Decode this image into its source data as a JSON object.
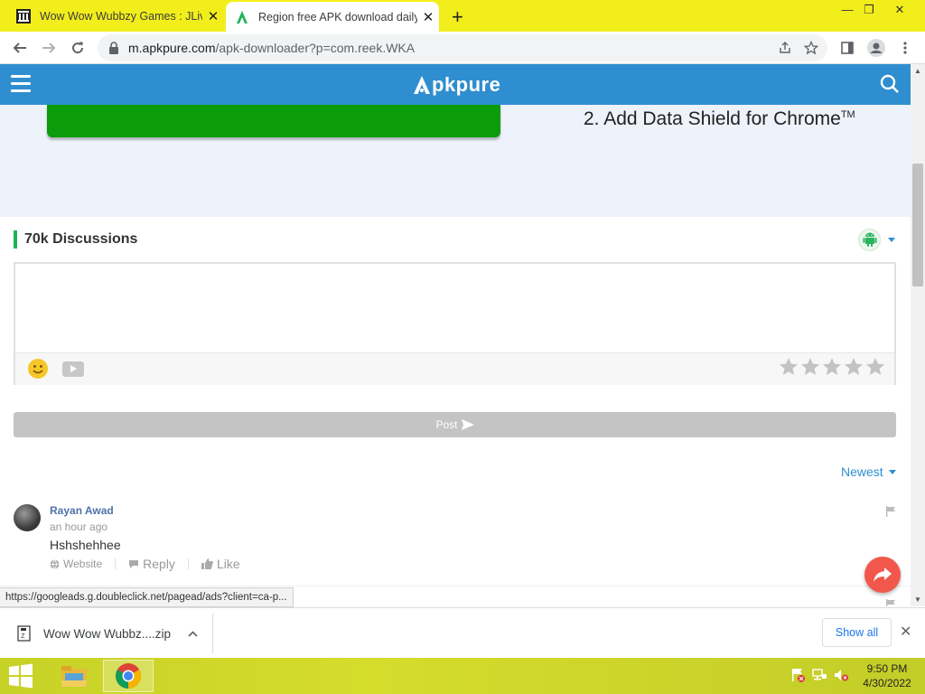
{
  "browser": {
    "tabs": [
      {
        "title": "Wow Wow Wubbzy Games : JLive",
        "active": false
      },
      {
        "title": "Region free APK download daily",
        "active": true
      }
    ],
    "new_tab": "+",
    "window_controls": {
      "minimize": "—",
      "maximize": "❐",
      "close": "✕"
    },
    "url_host": "m.apkpure.com",
    "url_path": "/apk-downloader?p=com.reek.WKA",
    "status_url": "https://googleads.g.doubleclick.net/pagead/ads?client=ca-p..."
  },
  "site": {
    "brand": "pkpure",
    "brand_color": "#2f8ecf",
    "ad_text": "2. Add Data Shield for Chrome",
    "ad_tm": "TM"
  },
  "discussion": {
    "title": "70k Discussions",
    "input_placeholder": "",
    "rating_stars": 5,
    "post_label": "Post",
    "sort_label": "Newest",
    "comments": [
      {
        "user": "Rayan Awad",
        "time": "an hour ago",
        "text": "Hshshehhee",
        "actions": {
          "website": "Website",
          "reply": "Reply",
          "like": "Like"
        }
      }
    ]
  },
  "downloads": {
    "file_name": "Wow Wow Wubbz....zip",
    "show_all": "Show all"
  },
  "taskbar": {
    "time": "9:50 PM",
    "date": "4/30/2022"
  }
}
